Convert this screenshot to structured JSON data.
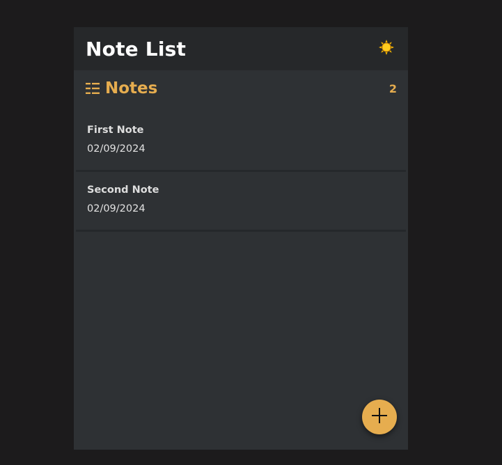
{
  "header": {
    "title": "Note List",
    "theme_icon": "sun-icon"
  },
  "section": {
    "icon": "list-icon",
    "title": "Notes",
    "count": "2"
  },
  "notes": [
    {
      "title": "First Note",
      "date": "02/09/2024"
    },
    {
      "title": "Second Note",
      "date": "02/09/2024"
    }
  ],
  "fab": {
    "icon": "plus-icon"
  },
  "colors": {
    "accent": "#e6ad4f",
    "background": "#1c1b1c",
    "panel": "#2e3134",
    "header": "#26282a"
  }
}
